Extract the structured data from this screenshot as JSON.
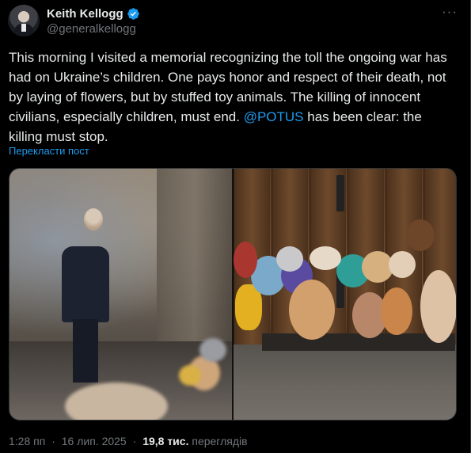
{
  "author": {
    "display_name": "Keith Kellogg",
    "handle": "@generalkellogg",
    "verified_icon": "verified-badge-icon"
  },
  "post": {
    "text_before_mention": "This morning I visited a memorial recognizing the toll the ongoing war has had on Ukraine’s children. One pays honor and respect of their death, not by laying of flowers, but by stuffed toy animals. The killing of innocent civilians, especially children, must end. ",
    "mention": "@POTUS",
    "text_after_mention": " has been clear: the killing must stop.",
    "translate_label": "Перекласти пост",
    "more_icon": "ellipsis-icon"
  },
  "meta": {
    "time": "1:28 пп",
    "date": "16 лип. 2025",
    "views_count": "19,8 тис.",
    "views_label": "переглядів",
    "dot": "·"
  },
  "colors": {
    "accent": "#1d9bf0",
    "text_primary": "#e7e9ea",
    "text_secondary": "#71767b",
    "background": "#000000"
  }
}
